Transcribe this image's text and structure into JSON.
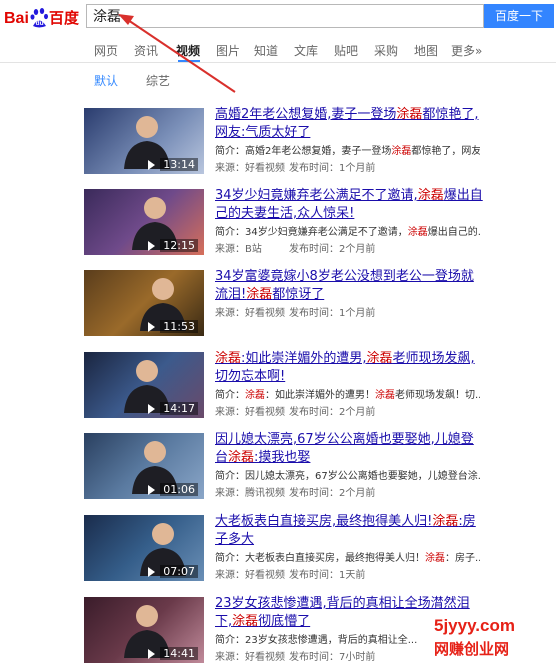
{
  "header": {
    "logo_text_left": "Bai",
    "logo_text_right": "百度",
    "search_value": "涂磊",
    "search_button": "百度一下"
  },
  "tabs": [
    {
      "label": "网页"
    },
    {
      "label": "资讯"
    },
    {
      "label": "视频"
    },
    {
      "label": "图片"
    },
    {
      "label": "知道"
    },
    {
      "label": "文库"
    },
    {
      "label": "贴吧"
    },
    {
      "label": "采购"
    },
    {
      "label": "地图"
    },
    {
      "label": "更多»"
    }
  ],
  "active_tab": "视频",
  "subtabs": [
    {
      "label": "默认"
    },
    {
      "label": "综艺"
    }
  ],
  "results": [
    {
      "title_parts": [
        "高婚2年老公想复婚,妻子一登场",
        "涂磊",
        "都惊艳了,网友:气质太好了"
      ],
      "summary_parts": [
        "简介：高婚2年老公想复婚，妻子一登场",
        "涂磊",
        "都惊艳了，网友..."
      ],
      "source": "来源：好看视频",
      "time": "发布时间：1个月前",
      "duration": "13:14"
    },
    {
      "title_parts": [
        "34岁少妇竟嫌弃老公满足不了邀请,",
        "涂磊",
        "爆出自己的夫妻生活,众人惊呆!"
      ],
      "summary_parts": [
        "简介：34岁少妇竟嫌弃老公满足不了邀请，",
        "涂磊",
        "爆出自己的..."
      ],
      "source": "来源：B站",
      "time": "发布时间：2个月前",
      "duration": "12:15"
    },
    {
      "title_parts": [
        "34岁富婆竟嫁小8岁老公没想到老公一登场就流泪!",
        "涂磊",
        "都惊讶了"
      ],
      "summary_parts": [],
      "source": "来源：好看视频",
      "time": "发布时间：1个月前",
      "duration": "11:53"
    },
    {
      "title_parts": [
        "涂磊",
        ":如此崇洋媚外的遭男,",
        "涂磊",
        "老师现场发飙,切勿忘本啊!"
      ],
      "summary_parts": [
        "简介：",
        "涂磊",
        "：如此崇洋媚外的遭男！",
        "涂磊",
        "老师现场发飙！切..."
      ],
      "source": "来源：好看视频",
      "time": "发布时间：2个月前",
      "duration": "14:17"
    },
    {
      "title_parts": [
        "因儿媳太漂亮,67岁公公离婚也要娶她,儿媳登台",
        "涂磊",
        ":摸我也娶"
      ],
      "summary_parts": [
        "简介：因儿媳太漂亮，67岁公公离婚也要娶她，儿媳登台涂..."
      ],
      "source": "来源：腾讯视频",
      "time": "发布时间：2个月前",
      "duration": "01:06"
    },
    {
      "title_parts": [
        "大老板表白直接买房,最终抱得美人归!",
        "涂磊",
        ":房子多大"
      ],
      "summary_parts": [
        "简介：大老板表白直接买房，最终抱得美人归！",
        "涂磊",
        "：房子..."
      ],
      "source": "来源：好看视频",
      "time": "发布时间：1天前",
      "duration": "07:07"
    },
    {
      "title_parts": [
        "23岁女孩悲惨遭遇,背后的真相让全场潸然泪下,",
        "涂磊",
        "彻底懵了"
      ],
      "summary_parts": [
        "简介：23岁女孩悲惨遭遇，背后的真相让全..."
      ],
      "source": "来源：好看视频",
      "time": "发布时间：7小时前",
      "duration": "14:41"
    }
  ],
  "watermark": {
    "line1": "5jyyy.com",
    "line2": "网赚创业网"
  },
  "colors": {
    "accent": "#3385ff",
    "link": "#1a0dab",
    "highlight": "#cc0000",
    "watermark": "#e62117"
  }
}
